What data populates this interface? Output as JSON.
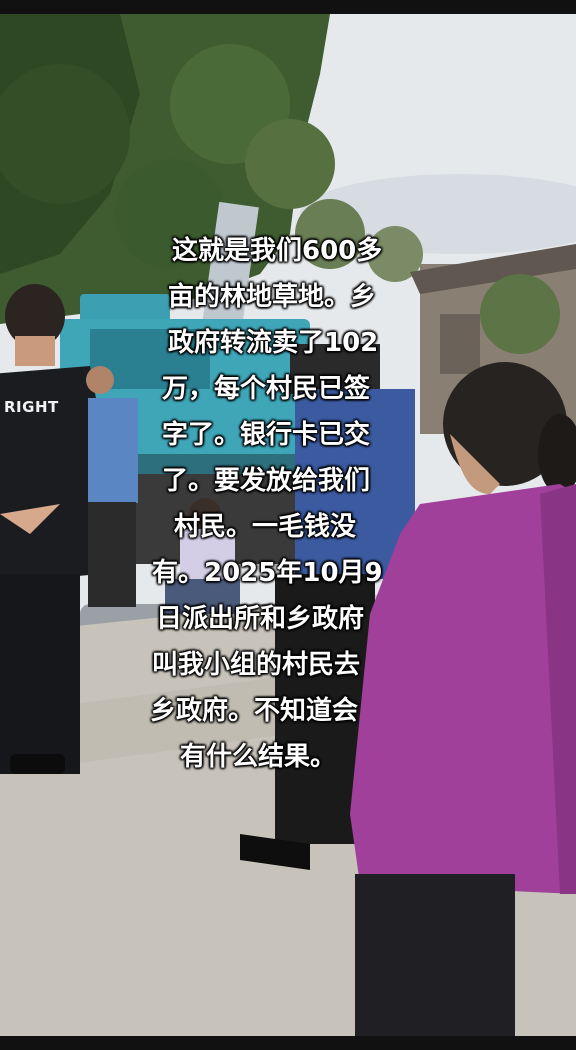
{
  "caption": {
    "lines": [
      "这就是我们600多",
      "亩的林地草地。乡",
      "政府转流卖了102",
      "万，每个村民已签",
      "字了。银行卡已交",
      "了。要发放给我们",
      "村民。一毛钱没",
      "有。2025年10月9",
      "日派出所和乡政府",
      "叫我小组的村民去",
      "乡政府。不知道会",
      "有什么结果。"
    ]
  },
  "shirt_logo": "RIGHT",
  "colors": {
    "sky": "#e9ecef",
    "foliage": "#3c5a2e",
    "excavator": "#3fa6b8",
    "ground": "#c9c4bb",
    "purple_jacket": "#a0409a",
    "black_shirt": "#1b1c20",
    "blue_shirt": "#5a86c4"
  }
}
